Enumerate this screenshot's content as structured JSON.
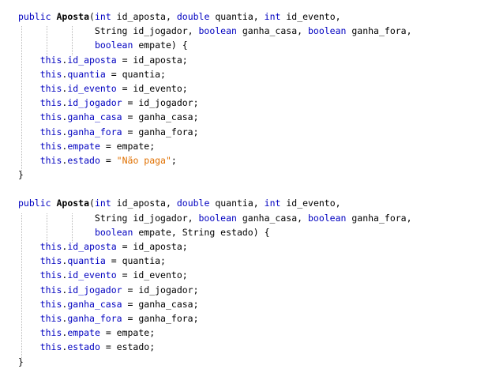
{
  "theme": {
    "background": "#ffffff",
    "text_color": "#000000",
    "keyword_color": "#0000c0",
    "field_color": "#0000c0",
    "string_color": "#e07000",
    "guide_color": "#b8b8b8"
  },
  "code_lines": [
    [
      {
        "t": "public",
        "c": "kw"
      },
      {
        "t": " "
      },
      {
        "t": "Aposta",
        "c": "fn"
      },
      {
        "t": "("
      },
      {
        "t": "int",
        "c": "kw"
      },
      {
        "t": " id_aposta, "
      },
      {
        "t": "double",
        "c": "kw"
      },
      {
        "t": " quantia, "
      },
      {
        "t": "int",
        "c": "kw"
      },
      {
        "t": " id_evento,"
      }
    ],
    [
      {
        "t": "              String id_jogador, "
      },
      {
        "t": "boolean",
        "c": "kw"
      },
      {
        "t": " ganha_casa, "
      },
      {
        "t": "boolean",
        "c": "kw"
      },
      {
        "t": " ganha_fora,"
      }
    ],
    [
      {
        "t": "              "
      },
      {
        "t": "boolean",
        "c": "kw"
      },
      {
        "t": " empate) {"
      }
    ],
    [
      {
        "t": "    "
      },
      {
        "t": "this",
        "c": "kw"
      },
      {
        "t": "."
      },
      {
        "t": "id_aposta",
        "c": "fld"
      },
      {
        "t": " = id_aposta;"
      }
    ],
    [
      {
        "t": "    "
      },
      {
        "t": "this",
        "c": "kw"
      },
      {
        "t": "."
      },
      {
        "t": "quantia",
        "c": "fld"
      },
      {
        "t": " = quantia;"
      }
    ],
    [
      {
        "t": "    "
      },
      {
        "t": "this",
        "c": "kw"
      },
      {
        "t": "."
      },
      {
        "t": "id_evento",
        "c": "fld"
      },
      {
        "t": " = id_evento;"
      }
    ],
    [
      {
        "t": "    "
      },
      {
        "t": "this",
        "c": "kw"
      },
      {
        "t": "."
      },
      {
        "t": "id_jogador",
        "c": "fld"
      },
      {
        "t": " = id_jogador;"
      }
    ],
    [
      {
        "t": "    "
      },
      {
        "t": "this",
        "c": "kw"
      },
      {
        "t": "."
      },
      {
        "t": "ganha_casa",
        "c": "fld"
      },
      {
        "t": " = ganha_casa;"
      }
    ],
    [
      {
        "t": "    "
      },
      {
        "t": "this",
        "c": "kw"
      },
      {
        "t": "."
      },
      {
        "t": "ganha_fora",
        "c": "fld"
      },
      {
        "t": " = ganha_fora;"
      }
    ],
    [
      {
        "t": "    "
      },
      {
        "t": "this",
        "c": "kw"
      },
      {
        "t": "."
      },
      {
        "t": "empate",
        "c": "fld"
      },
      {
        "t": " = empate;"
      }
    ],
    [
      {
        "t": "    "
      },
      {
        "t": "this",
        "c": "kw"
      },
      {
        "t": "."
      },
      {
        "t": "estado",
        "c": "fld"
      },
      {
        "t": " = "
      },
      {
        "t": "\"Não paga\"",
        "c": "str"
      },
      {
        "t": ";"
      }
    ],
    [
      {
        "t": "}"
      }
    ],
    [
      {
        "t": ""
      }
    ],
    [
      {
        "t": "public",
        "c": "kw"
      },
      {
        "t": " "
      },
      {
        "t": "Aposta",
        "c": "fn"
      },
      {
        "t": "("
      },
      {
        "t": "int",
        "c": "kw"
      },
      {
        "t": " id_aposta, "
      },
      {
        "t": "double",
        "c": "kw"
      },
      {
        "t": " quantia, "
      },
      {
        "t": "int",
        "c": "kw"
      },
      {
        "t": " id_evento,"
      }
    ],
    [
      {
        "t": "              String id_jogador, "
      },
      {
        "t": "boolean",
        "c": "kw"
      },
      {
        "t": " ganha_casa, "
      },
      {
        "t": "boolean",
        "c": "kw"
      },
      {
        "t": " ganha_fora,"
      }
    ],
    [
      {
        "t": "              "
      },
      {
        "t": "boolean",
        "c": "kw"
      },
      {
        "t": " empate, String estado) {"
      }
    ],
    [
      {
        "t": "    "
      },
      {
        "t": "this",
        "c": "kw"
      },
      {
        "t": "."
      },
      {
        "t": "id_aposta",
        "c": "fld"
      },
      {
        "t": " = id_aposta;"
      }
    ],
    [
      {
        "t": "    "
      },
      {
        "t": "this",
        "c": "kw"
      },
      {
        "t": "."
      },
      {
        "t": "quantia",
        "c": "fld"
      },
      {
        "t": " = quantia;"
      }
    ],
    [
      {
        "t": "    "
      },
      {
        "t": "this",
        "c": "kw"
      },
      {
        "t": "."
      },
      {
        "t": "id_evento",
        "c": "fld"
      },
      {
        "t": " = id_evento;"
      }
    ],
    [
      {
        "t": "    "
      },
      {
        "t": "this",
        "c": "kw"
      },
      {
        "t": "."
      },
      {
        "t": "id_jogador",
        "c": "fld"
      },
      {
        "t": " = id_jogador;"
      }
    ],
    [
      {
        "t": "    "
      },
      {
        "t": "this",
        "c": "kw"
      },
      {
        "t": "."
      },
      {
        "t": "ganha_casa",
        "c": "fld"
      },
      {
        "t": " = ganha_casa;"
      }
    ],
    [
      {
        "t": "    "
      },
      {
        "t": "this",
        "c": "kw"
      },
      {
        "t": "."
      },
      {
        "t": "ganha_fora",
        "c": "fld"
      },
      {
        "t": " = ganha_fora;"
      }
    ],
    [
      {
        "t": "    "
      },
      {
        "t": "this",
        "c": "kw"
      },
      {
        "t": "."
      },
      {
        "t": "empate",
        "c": "fld"
      },
      {
        "t": " = empate;"
      }
    ],
    [
      {
        "t": "    "
      },
      {
        "t": "this",
        "c": "kw"
      },
      {
        "t": "."
      },
      {
        "t": "estado",
        "c": "fld"
      },
      {
        "t": " = estado;"
      }
    ],
    [
      {
        "t": "}"
      }
    ]
  ]
}
